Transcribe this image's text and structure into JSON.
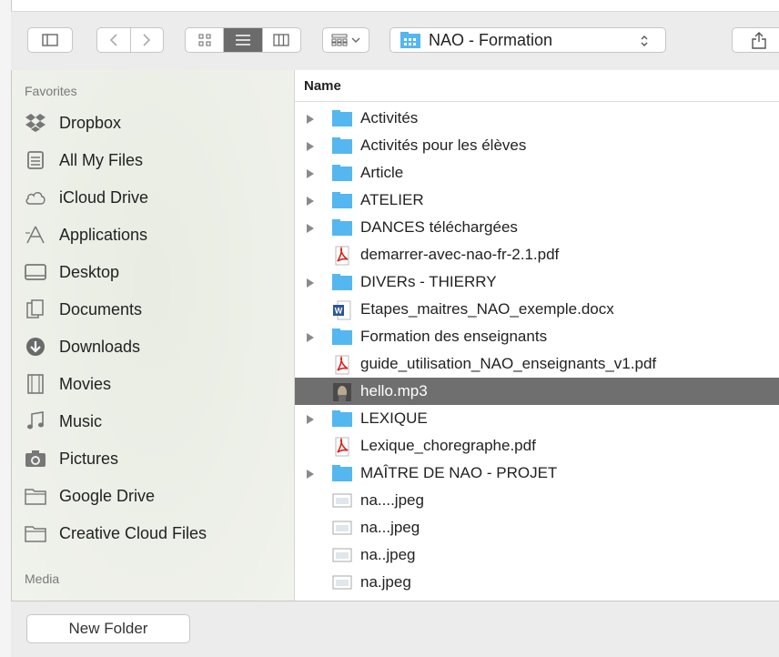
{
  "toolbar": {
    "path_label": "NAO - Formation"
  },
  "sidebar": {
    "favorites_header": "Favorites",
    "items": [
      {
        "label": "Dropbox",
        "icon": "dropbox-icon"
      },
      {
        "label": "All My Files",
        "icon": "all-my-files-icon"
      },
      {
        "label": "iCloud Drive",
        "icon": "cloud-icon"
      },
      {
        "label": "Applications",
        "icon": "applications-icon"
      },
      {
        "label": "Desktop",
        "icon": "desktop-icon"
      },
      {
        "label": "Documents",
        "icon": "documents-icon"
      },
      {
        "label": "Downloads",
        "icon": "downloads-icon"
      },
      {
        "label": "Movies",
        "icon": "movies-icon"
      },
      {
        "label": "Music",
        "icon": "music-icon"
      },
      {
        "label": "Pictures",
        "icon": "camera-icon"
      },
      {
        "label": "Google Drive",
        "icon": "folder-icon"
      },
      {
        "label": "Creative Cloud Files",
        "icon": "folder-icon"
      }
    ],
    "media_header": "Media"
  },
  "list": {
    "column_name": "Name",
    "rows": [
      {
        "name": "Activités",
        "kind": "folder",
        "expandable": true
      },
      {
        "name": "Activités pour les élèves",
        "kind": "folder",
        "expandable": true
      },
      {
        "name": "Article",
        "kind": "folder",
        "expandable": true
      },
      {
        "name": "ATELIER",
        "kind": "folder",
        "expandable": true
      },
      {
        "name": "DANCES téléchargées",
        "kind": "folder",
        "expandable": true
      },
      {
        "name": "demarrer-avec-nao-fr-2.1.pdf",
        "kind": "pdf",
        "expandable": false
      },
      {
        "name": "DIVERs - THIERRY",
        "kind": "folder",
        "expandable": true
      },
      {
        "name": "Etapes_maitres_NAO_exemple.docx",
        "kind": "docx",
        "expandable": false
      },
      {
        "name": "Formation des enseignants",
        "kind": "folder",
        "expandable": true
      },
      {
        "name": "guide_utilisation_NAO_enseignants_v1.pdf",
        "kind": "pdf",
        "expandable": false
      },
      {
        "name": "hello.mp3",
        "kind": "mp3",
        "expandable": false,
        "selected": true
      },
      {
        "name": "LEXIQUE",
        "kind": "folder",
        "expandable": true
      },
      {
        "name": "Lexique_choregraphe.pdf",
        "kind": "pdf",
        "expandable": false
      },
      {
        "name": "MAÎTRE DE NAO - PROJET",
        "kind": "folder",
        "expandable": true
      },
      {
        "name": "na....jpeg",
        "kind": "jpeg",
        "expandable": false
      },
      {
        "name": "na...jpeg",
        "kind": "jpeg",
        "expandable": false
      },
      {
        "name": "na..jpeg",
        "kind": "jpeg",
        "expandable": false
      },
      {
        "name": "na.jpeg",
        "kind": "jpeg",
        "expandable": false
      }
    ]
  },
  "footer": {
    "new_folder_label": "New Folder"
  },
  "colors": {
    "selection": "#6f6f6f",
    "folder": "#54b7f0",
    "pdf": "#d4251d"
  }
}
